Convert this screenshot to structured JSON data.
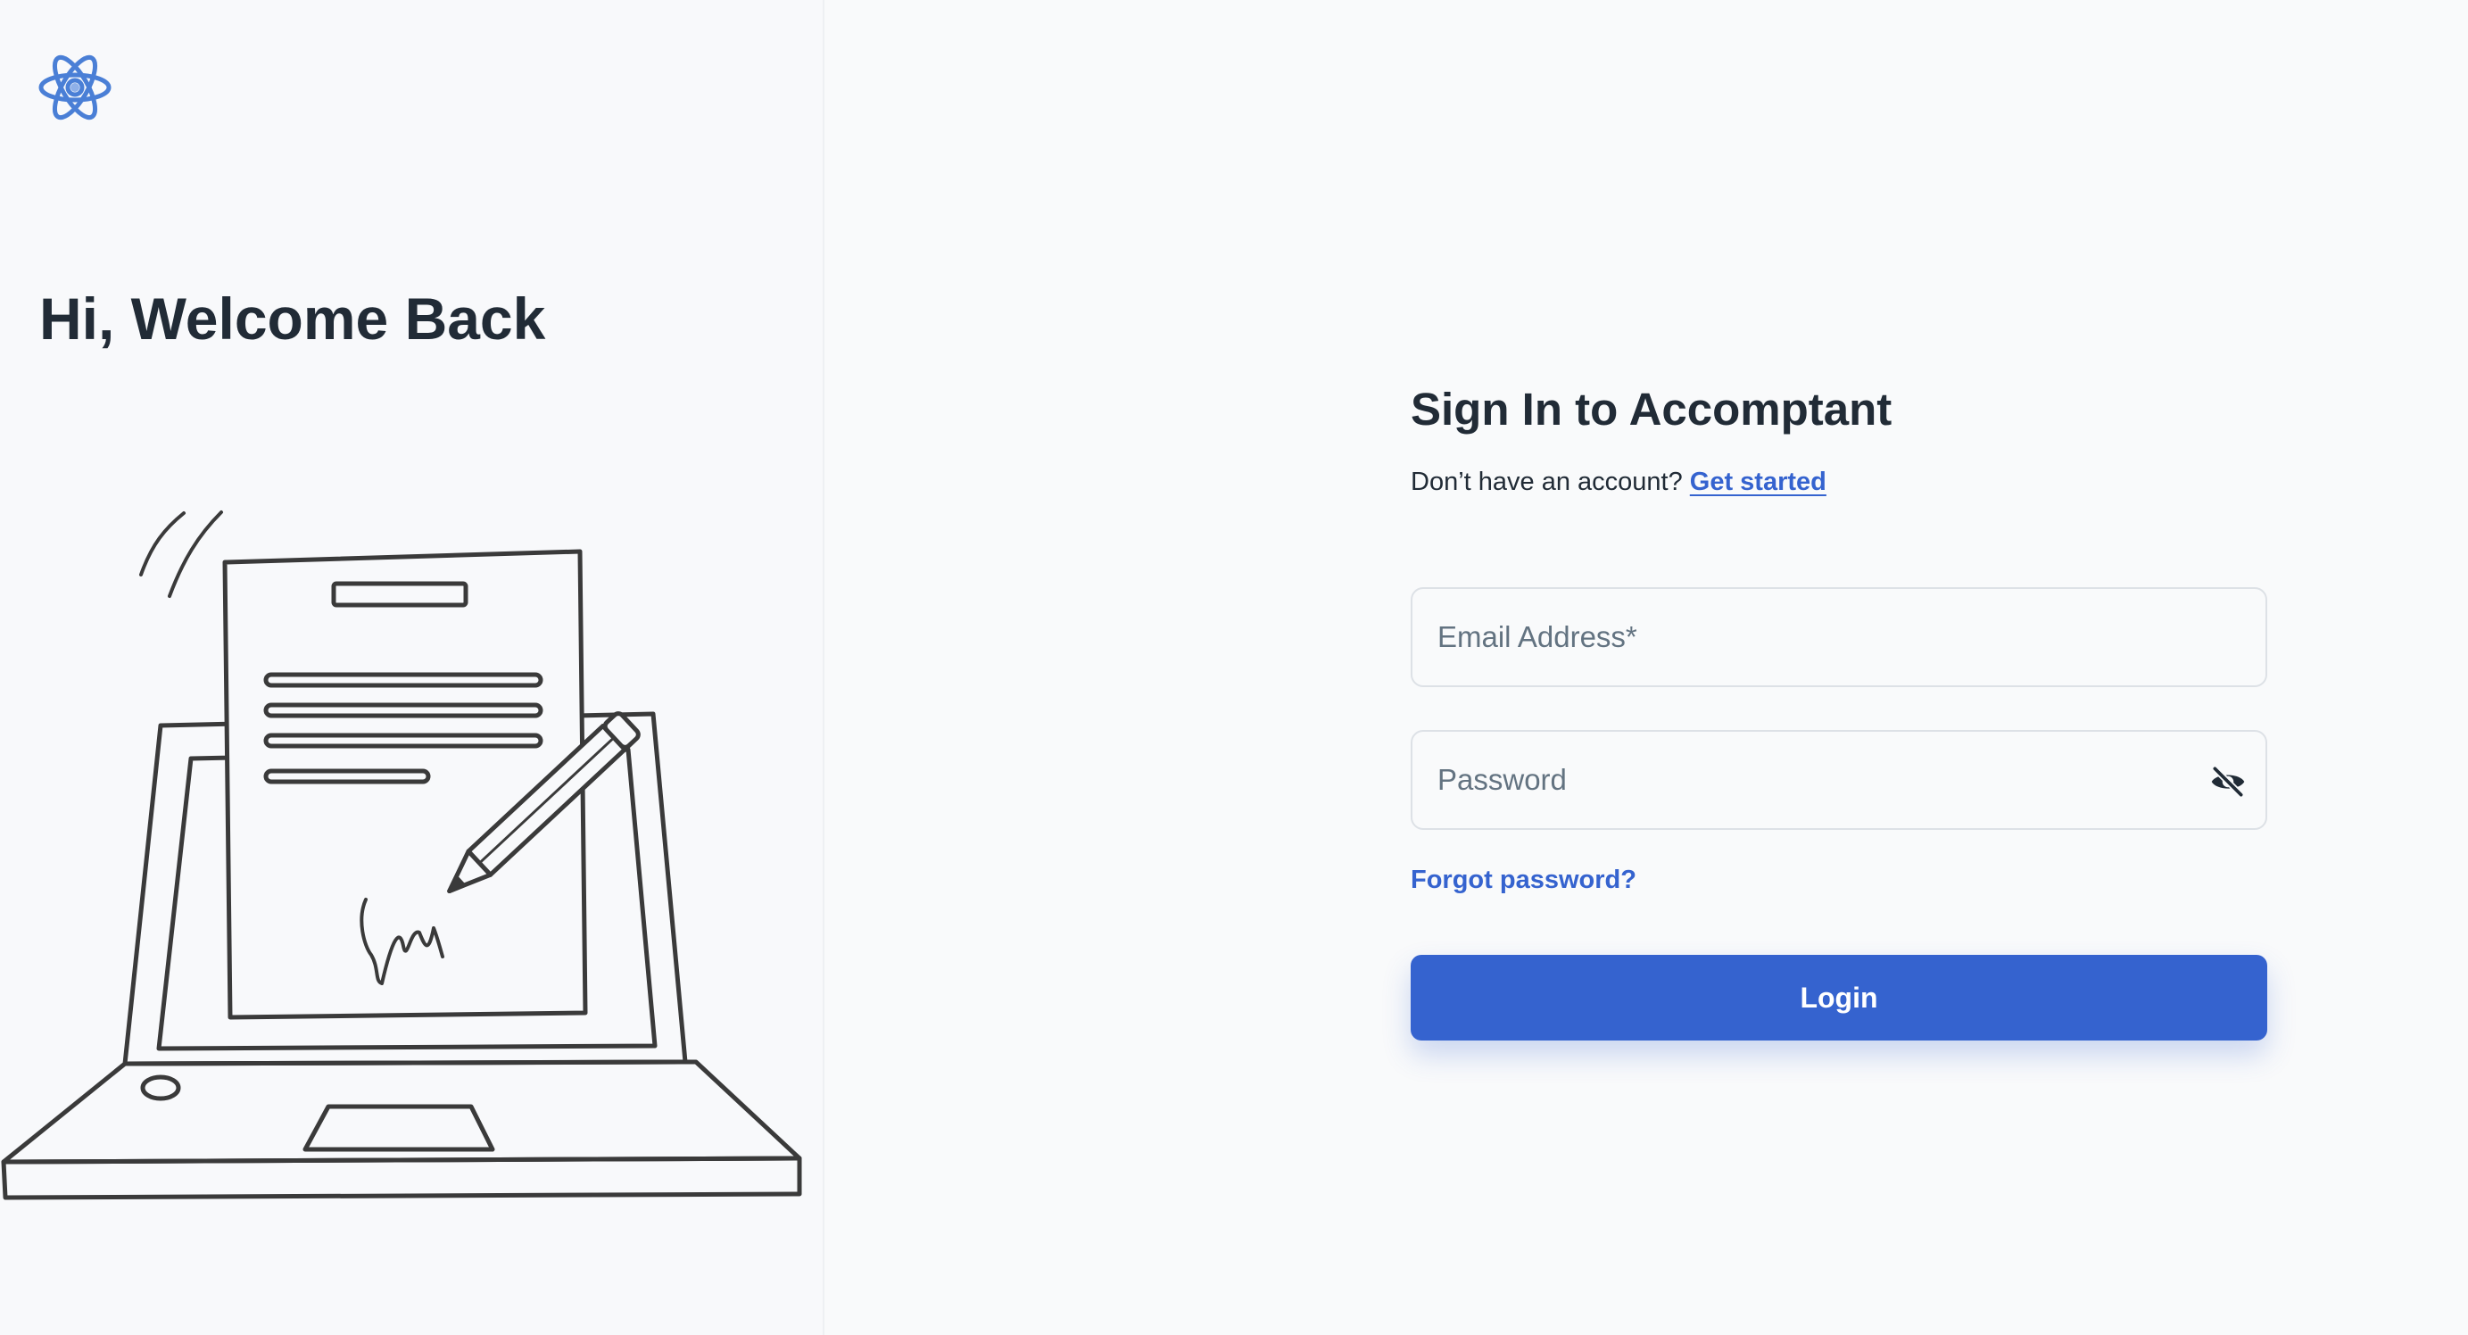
{
  "brand": {
    "logo_icon": "atom-icon",
    "accent_color": "#3563cf"
  },
  "left": {
    "heading": "Hi, Welcome Back",
    "illustration_icon": "laptop-signed-document-illustration"
  },
  "form": {
    "title": "Sign In to Accomptant",
    "signup_prompt": "Don’t have an account?",
    "signup_link": "Get started",
    "email_placeholder": "Email Address*",
    "password_placeholder": "Password",
    "password_toggle_icon": "eye-off-icon",
    "forgot_link": "Forgot password?",
    "login_label": "Login"
  }
}
